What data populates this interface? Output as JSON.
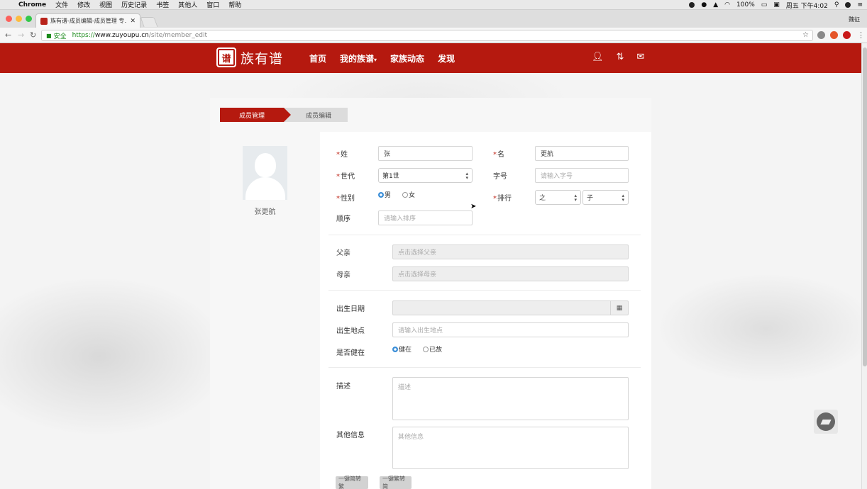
{
  "os_menu": {
    "apple": "",
    "items": [
      "Chrome",
      "文件",
      "修改",
      "视图",
      "历史记录",
      "书签",
      "其他人",
      "窗口",
      "帮助"
    ],
    "battery": "100%",
    "clock": "周五 下午4:02"
  },
  "browser": {
    "tab_title": "族有谱-成员编辑-成员管理 专…",
    "profile_name": "魏征",
    "secure_label": "安全",
    "url_scheme": "https://",
    "url_host": "www.zuyoupu.cn",
    "url_path": "/site/member_edit"
  },
  "site": {
    "logo_seal": "谱",
    "logo_text": "族有谱",
    "nav": [
      {
        "label": "首页"
      },
      {
        "label": "我的族谱"
      },
      {
        "label": "家族动态"
      },
      {
        "label": "发现"
      }
    ],
    "nav_dropdown_caret": "▾"
  },
  "breadcrumb": {
    "step1": "成员管理",
    "step2": "成员编辑"
  },
  "member": {
    "display_name": "张更航"
  },
  "form": {
    "surname_label": "姓",
    "surname_value": "张",
    "given_label": "名",
    "given_value": "更航",
    "generation_label": "世代",
    "generation_value": "第1世",
    "courtesy_label": "字号",
    "courtesy_placeholder": "请输入字号",
    "gender_label": "性别",
    "gender_male": "男",
    "gender_female": "女",
    "rank_label": "排行",
    "rank_value1": "之",
    "rank_value2": "子",
    "order_label": "顺序",
    "order_placeholder": "请输入排序",
    "father_label": "父亲",
    "father_placeholder": "点击选择父亲",
    "mother_label": "母亲",
    "mother_placeholder": "点击选择母亲",
    "birthdate_label": "出生日期",
    "birthplace_label": "出生地点",
    "birthplace_placeholder": "请输入出生地点",
    "alive_label": "是否健在",
    "alive_yes": "健在",
    "alive_no": "已故",
    "desc_label": "描述",
    "desc_placeholder": "描述",
    "other_label": "其他信息",
    "other_placeholder": "其他信息",
    "btn_to_traditional": "一键简转繁",
    "btn_to_simplified": "一键繁转简"
  },
  "required_mark": "*"
}
